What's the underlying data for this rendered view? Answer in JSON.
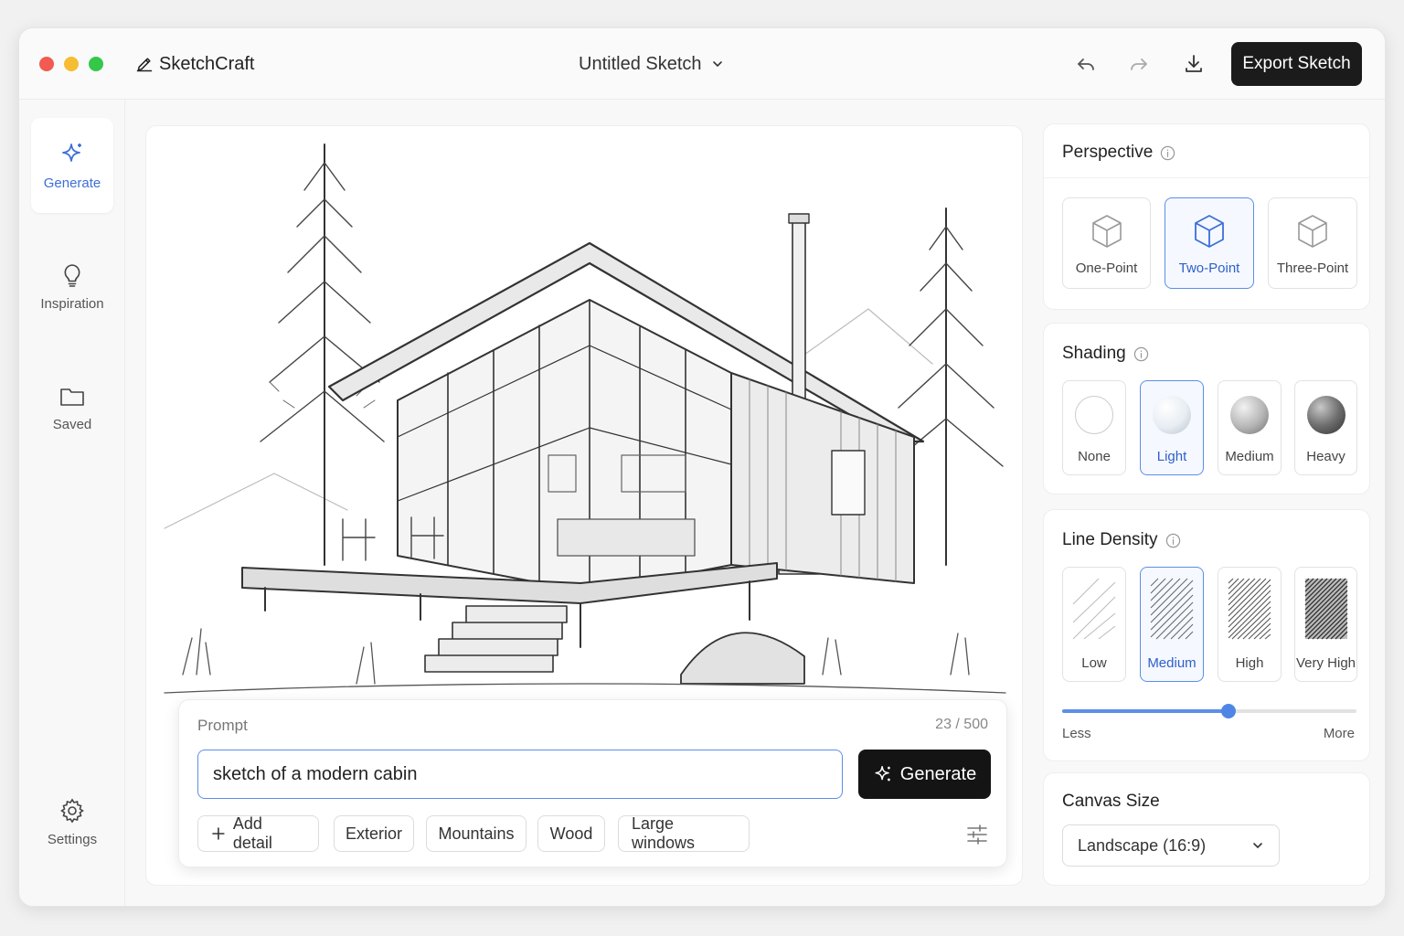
{
  "app": {
    "name": "SketchCraft",
    "document_title": "Untitled Sketch",
    "export_label": "Export Sketch"
  },
  "sidebar": {
    "items": [
      {
        "label": "Generate",
        "icon": "sparkle-icon",
        "active": true
      },
      {
        "label": "Inspiration",
        "icon": "lightbulb-icon"
      },
      {
        "label": "Saved",
        "icon": "folder-icon"
      },
      {
        "label": "Settings",
        "icon": "gear-icon"
      }
    ]
  },
  "prompt": {
    "label": "Prompt",
    "count": "23 / 500",
    "value": "sketch of a modern cabin",
    "generate_label": "Generate",
    "chips": [
      "Add detail",
      "Exterior",
      "Mountains",
      "Wood",
      "Large windows"
    ]
  },
  "perspective": {
    "title": "Perspective",
    "options": [
      "One-Point",
      "Two-Point",
      "Three-Point"
    ],
    "selected": "Two-Point"
  },
  "shading": {
    "title": "Shading",
    "options": [
      "None",
      "Light",
      "Medium",
      "Heavy"
    ],
    "selected": "Light"
  },
  "line_density": {
    "title": "Line Density",
    "options": [
      "Low",
      "Medium",
      "High",
      "Very High"
    ],
    "selected": "Medium",
    "slider_value": 0.565,
    "min_label": "Less",
    "max_label": "More"
  },
  "canvas_size": {
    "title": "Canvas Size",
    "value": "Landscape (16:9)"
  },
  "colors": {
    "accent": "#5b8fe8",
    "dark": "#1b1b1b"
  }
}
